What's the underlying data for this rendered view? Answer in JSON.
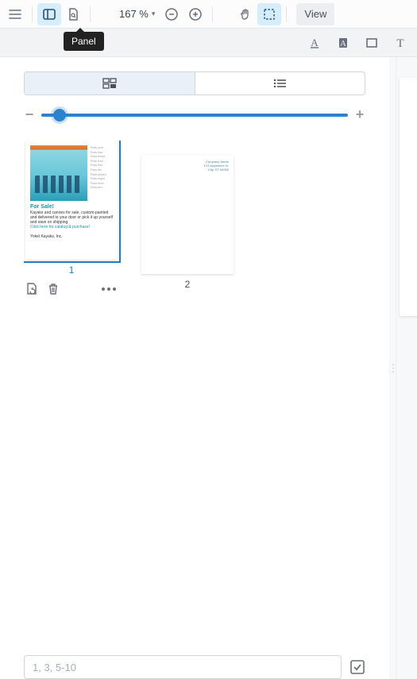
{
  "toolbar": {
    "zoom_value": "167 %",
    "view_label": "View"
  },
  "tooltip": {
    "panel": "Panel"
  },
  "sidepanel": {
    "page_input_placeholder": "1, 3, 5-10"
  },
  "thumbnails": [
    {
      "num": "1",
      "selected": true,
      "content": {
        "headline": "For Sale!",
        "body": "Kayaks and canoes for sale, custom-painted and delivered to your door or pick it up yourself and save on shipping.",
        "link": "Click here for catalog & purchase!",
        "signature": "Yokel Kayaks, Inc.",
        "sidebar_lines": [
          "Row one",
          "Row two",
          "Row three",
          "Row four",
          "Row five",
          "Row six",
          "Row seven",
          "Row eight",
          "Row nine",
          "Row ten"
        ]
      }
    },
    {
      "num": "2",
      "selected": false,
      "content": {
        "addr_lines": [
          "Company Name",
          "123 Anywhere St.",
          "City, ST 00000"
        ]
      }
    }
  ],
  "icons": {
    "menu": "≡",
    "minus": "−",
    "plus": "+"
  }
}
